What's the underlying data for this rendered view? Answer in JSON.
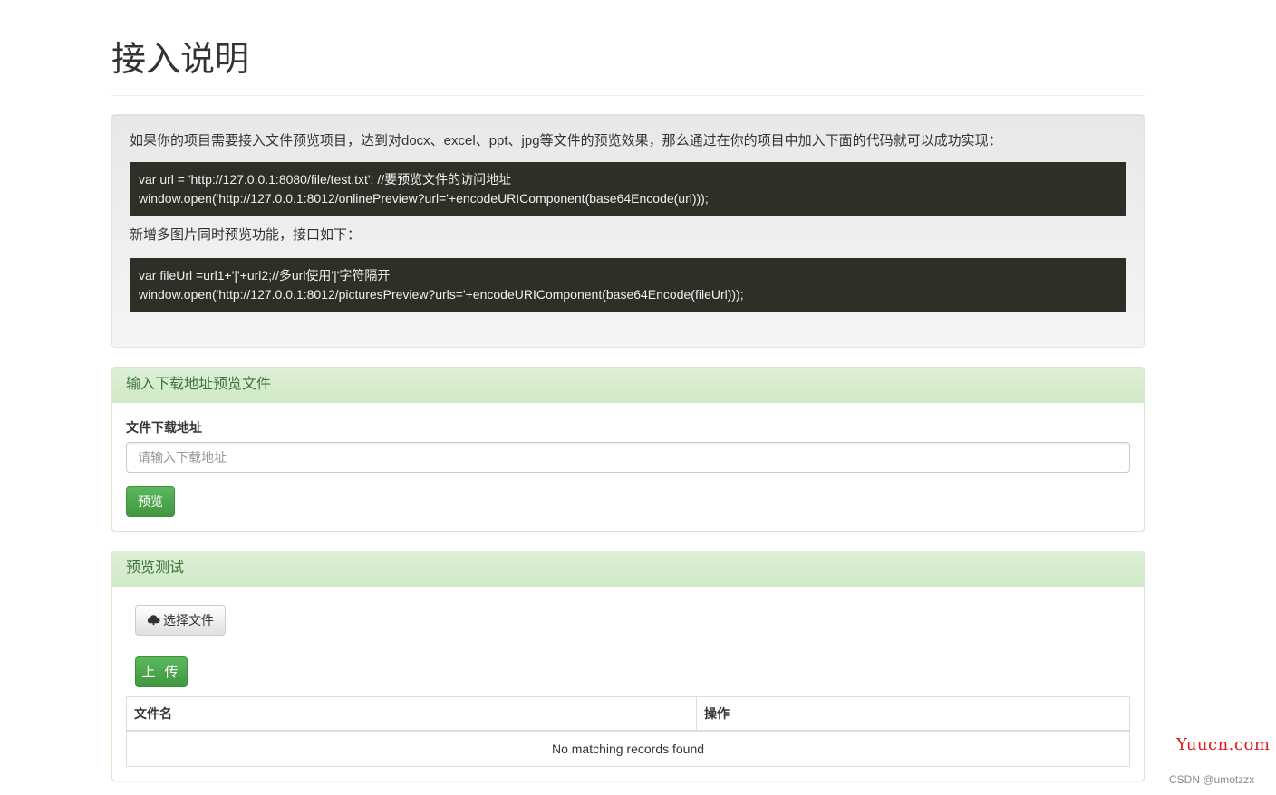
{
  "page": {
    "title": "接入说明"
  },
  "intro": {
    "description": "如果你的项目需要接入文件预览项目，达到对docx、excel、ppt、jpg等文件的预览效果，那么通过在你的项目中加入下面的代码就可以成功实现：",
    "code1": [
      "var url = 'http://127.0.0.1:8080/file/test.txt'; //要预览文件的访问地址",
      "window.open('http://127.0.0.1:8012/onlinePreview?url='+encodeURIComponent(base64Encode(url)));"
    ],
    "multi_image_note": "新增多图片同时预览功能，接口如下：",
    "code2": [
      "var fileUrl =url1+'|'+url2;//多url使用'|'字符隔开",
      "window.open('http://127.0.0.1:8012/picturesPreview?urls='+encodeURIComponent(base64Encode(fileUrl)));"
    ]
  },
  "url_panel": {
    "heading": "输入下载地址预览文件",
    "field_label": "文件下载地址",
    "input_placeholder": "请输入下载地址",
    "input_value": "",
    "preview_button": "预览"
  },
  "test_panel": {
    "heading": "预览测试",
    "choose_button": "选择文件",
    "choose_icon": "cloud-upload-icon",
    "upload_button": "上 传",
    "table": {
      "columns": [
        "文件名",
        "操作"
      ],
      "empty_message": "No matching records found"
    }
  },
  "watermarks": {
    "site": "Yuucn.com",
    "csdn": "CSDN @umotzzx"
  },
  "colors": {
    "success": "#5cb85c",
    "panel_heading_text": "#3c763d",
    "code_bg": "#2f2f28"
  }
}
